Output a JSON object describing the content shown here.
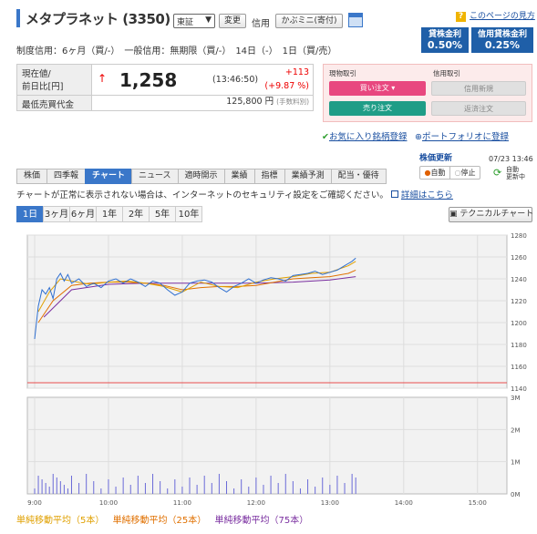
{
  "header": {
    "company": "メタプラネット (3350)",
    "exchange": "東証",
    "change_btn": "変更",
    "credit_label": "信用",
    "kabu_btn": "かぶミニ(寄付)",
    "help_link": "このページの見方"
  },
  "rates": [
    {
      "label": "貸株金利",
      "value": "0.50%"
    },
    {
      "label": "信用貸株金利",
      "value": "0.25%"
    }
  ],
  "info_line": "制度信用：6ヶ月（買/-）　一般信用：無期限（買/-）　14日（-）　1日（買/売）",
  "quote": {
    "price_label_1": "現在値/",
    "price_label_2": "前日比[円]",
    "arrow": "↑",
    "price": "1,258",
    "time": "(13:46:50)",
    "change": "+113",
    "change_pct": "(+9.87 %)",
    "min_label": "最低売買代金",
    "min_value": "125,800",
    "min_unit": "円",
    "fee_note": "(手数料別)"
  },
  "trade": {
    "cash_label": "現物取引",
    "margin_label": "信用取引",
    "buy": "買い注文 ▾",
    "sell": "売り注文",
    "margin_new": "信用新規",
    "margin_close": "返済注文"
  },
  "links": {
    "favorite": "お気に入り銘柄登録",
    "portfolio": "ポートフォリオに登録"
  },
  "update": {
    "title": "株価更新",
    "date": "07/23 13:46",
    "auto": "自動",
    "stop": "停止",
    "auto_update_1": "自動",
    "auto_update_2": "更新中"
  },
  "tabs": [
    "株価",
    "四季報",
    "チャート",
    "ニュース",
    "適時開示",
    "業績",
    "指標",
    "業績予測",
    "配当・優待"
  ],
  "note": "チャートが正常に表示されない場合は、インターネットのセキュリティ設定をご確認ください。",
  "note_link": "詳細はこちら",
  "periods": [
    "1日",
    "3ヶ月",
    "6ヶ月",
    "1年",
    "2年",
    "5年",
    "10年"
  ],
  "technical": "テクニカルチャート",
  "legend": [
    {
      "label": "単純移動平均（5本）",
      "color": "#e0a000"
    },
    {
      "label": "単純移動平均（25本）",
      "color": "#e07000"
    },
    {
      "label": "単純移動平均（75本）",
      "color": "#7a2fa0"
    }
  ],
  "chart_data": {
    "type": "line",
    "x_ticks": [
      "9:00",
      "10:00",
      "11:00",
      "12:00",
      "13:00",
      "14:00",
      "15:00"
    ],
    "y_ticks": [
      "1280",
      "1260",
      "1240",
      "1220",
      "1200",
      "1180",
      "1160",
      "1140"
    ],
    "ylim": [
      1140,
      1280
    ],
    "volume_ticks": [
      "3M",
      "2M",
      "1M",
      "0M"
    ],
    "reference_price": 1145,
    "price_series": [
      [
        0,
        1185
      ],
      [
        2,
        1215
      ],
      [
        4,
        1230
      ],
      [
        6,
        1226
      ],
      [
        8,
        1232
      ],
      [
        10,
        1222
      ],
      [
        12,
        1240
      ],
      [
        14,
        1245
      ],
      [
        16,
        1238
      ],
      [
        18,
        1244
      ],
      [
        20,
        1236
      ],
      [
        24,
        1240
      ],
      [
        28,
        1233
      ],
      [
        32,
        1236
      ],
      [
        36,
        1232
      ],
      [
        40,
        1238
      ],
      [
        44,
        1240
      ],
      [
        48,
        1236
      ],
      [
        52,
        1240
      ],
      [
        56,
        1237
      ],
      [
        60,
        1233
      ],
      [
        64,
        1238
      ],
      [
        68,
        1236
      ],
      [
        72,
        1230
      ],
      [
        76,
        1225
      ],
      [
        80,
        1228
      ],
      [
        84,
        1236
      ],
      [
        88,
        1238
      ],
      [
        92,
        1239
      ],
      [
        96,
        1237
      ],
      [
        100,
        1232
      ],
      [
        104,
        1228
      ],
      [
        108,
        1233
      ],
      [
        112,
        1236
      ],
      [
        116,
        1240
      ],
      [
        120,
        1236
      ],
      [
        124,
        1239
      ],
      [
        128,
        1241
      ],
      [
        132,
        1240
      ],
      [
        136,
        1238
      ],
      [
        140,
        1243
      ],
      [
        144,
        1244
      ],
      [
        148,
        1245
      ],
      [
        152,
        1247
      ],
      [
        156,
        1244
      ],
      [
        160,
        1246
      ],
      [
        164,
        1248
      ],
      [
        168,
        1252
      ],
      [
        172,
        1256
      ],
      [
        174,
        1259
      ]
    ],
    "ma5": [
      [
        2,
        1210
      ],
      [
        8,
        1228
      ],
      [
        14,
        1240
      ],
      [
        20,
        1238
      ],
      [
        30,
        1235
      ],
      [
        40,
        1237
      ],
      [
        50,
        1238
      ],
      [
        60,
        1236
      ],
      [
        70,
        1233
      ],
      [
        80,
        1228
      ],
      [
        90,
        1237
      ],
      [
        100,
        1233
      ],
      [
        110,
        1232
      ],
      [
        120,
        1237
      ],
      [
        130,
        1240
      ],
      [
        140,
        1242
      ],
      [
        150,
        1245
      ],
      [
        160,
        1246
      ],
      [
        170,
        1252
      ],
      [
        174,
        1256
      ]
    ],
    "ma25": [
      [
        2,
        1200
      ],
      [
        10,
        1220
      ],
      [
        20,
        1234
      ],
      [
        30,
        1236
      ],
      [
        40,
        1237
      ],
      [
        50,
        1237
      ],
      [
        60,
        1236
      ],
      [
        70,
        1234
      ],
      [
        80,
        1230
      ],
      [
        90,
        1232
      ],
      [
        100,
        1233
      ],
      [
        110,
        1233
      ],
      [
        120,
        1234
      ],
      [
        130,
        1237
      ],
      [
        140,
        1240
      ],
      [
        150,
        1241
      ],
      [
        160,
        1242
      ],
      [
        170,
        1245
      ],
      [
        174,
        1248
      ]
    ],
    "ma75": [
      [
        5,
        1205
      ],
      [
        20,
        1230
      ],
      [
        40,
        1235
      ],
      [
        60,
        1236
      ],
      [
        80,
        1236
      ],
      [
        100,
        1236
      ],
      [
        120,
        1236
      ],
      [
        140,
        1237
      ],
      [
        160,
        1239
      ],
      [
        174,
        1242
      ]
    ]
  }
}
